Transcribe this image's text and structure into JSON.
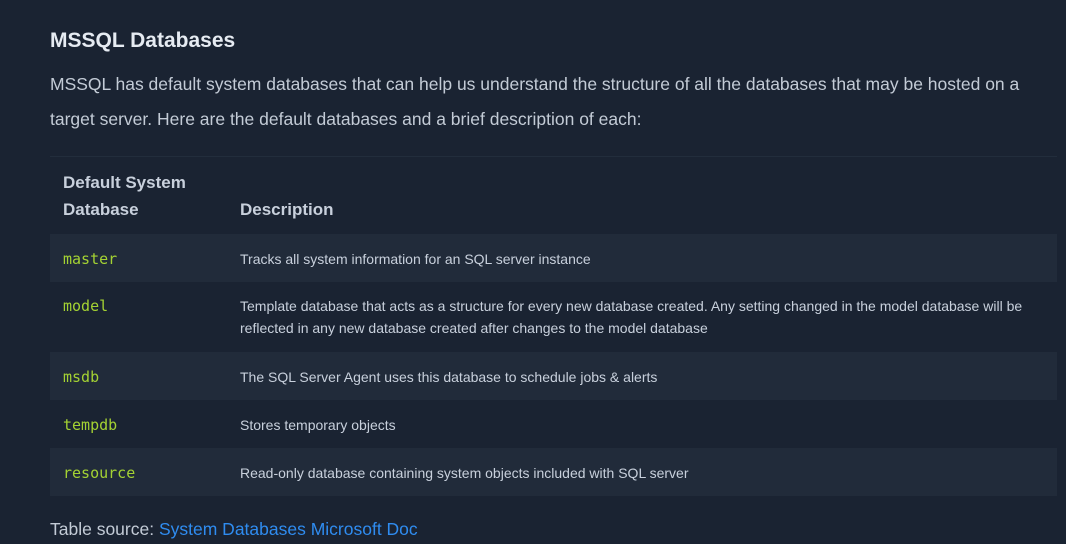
{
  "section": {
    "heading": "MSSQL Databases",
    "intro": "MSSQL has default system databases that can help us understand the structure of all the databases that may be hosted on a target server. Here are the default databases and a brief description of each:"
  },
  "table": {
    "headers": [
      "Default System Database",
      "Description"
    ],
    "rows": [
      {
        "name": "master",
        "description": "Tracks all system information for an SQL server instance"
      },
      {
        "name": "model",
        "description": "Template database that acts as a structure for every new database created. Any setting changed in the model database will be reflected in any new database created after changes to the model database"
      },
      {
        "name": "msdb",
        "description": "The SQL Server Agent uses this database to schedule jobs & alerts"
      },
      {
        "name": "tempdb",
        "description": "Stores temporary objects"
      },
      {
        "name": "resource",
        "description": "Read-only database containing system objects included with SQL server"
      }
    ]
  },
  "footer": {
    "source_label": "Table source:",
    "source_link_text": "System Databases Microsoft Doc"
  },
  "colors": {
    "background": "#1a2332",
    "row_stripe": "#212b3a",
    "code_green": "#a4d233",
    "link_blue": "#2f8cf0"
  }
}
